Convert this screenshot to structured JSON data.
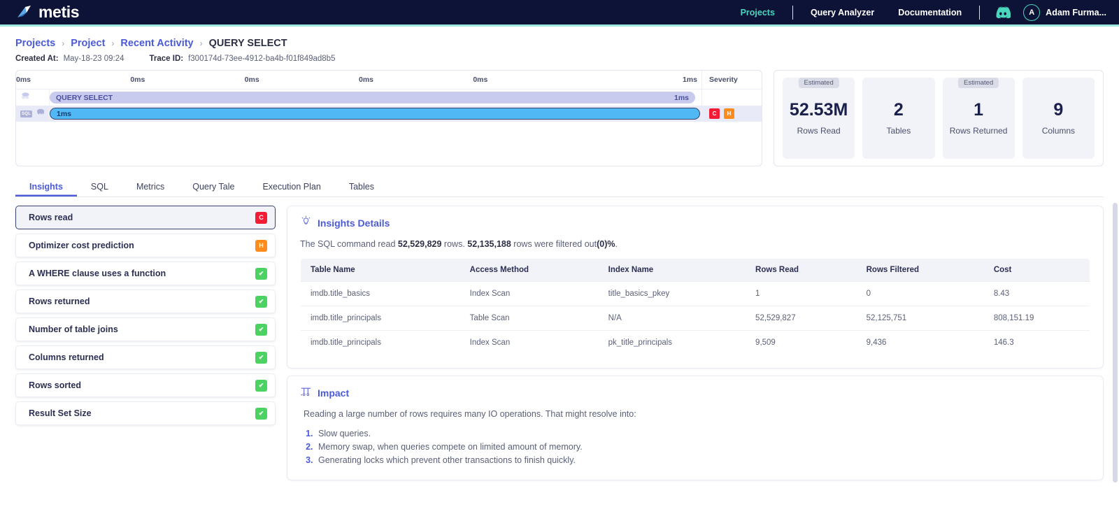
{
  "navbar": {
    "logo_text": "metis",
    "links": [
      {
        "label": "Projects",
        "active": true
      },
      {
        "label": "Query Analyzer",
        "active": false
      },
      {
        "label": "Documentation",
        "active": false
      }
    ],
    "discord_icon": "discord-icon",
    "avatar_initial": "A",
    "user_name": "Adam Furma..."
  },
  "breadcrumb": {
    "items": [
      {
        "label": "Projects"
      },
      {
        "label": "Project"
      },
      {
        "label": "Recent Activity"
      },
      {
        "label": "QUERY SELECT"
      }
    ],
    "separator": "›"
  },
  "meta": {
    "created_at_label": "Created At:",
    "created_at_value": "May-18-23 09:24",
    "trace_id_label": "Trace ID:",
    "trace_id_value": "f300174d-73ee-4912-ba4b-f01f849ad8b5"
  },
  "trace": {
    "ticks": [
      "0ms",
      "0ms",
      "0ms",
      "0ms",
      "0ms",
      "1ms"
    ],
    "severity_header": "Severity",
    "rows": [
      {
        "icon": "cloud-database-icon",
        "bar_label": "QUERY SELECT",
        "bar_duration": "1ms",
        "severities": []
      },
      {
        "icon_chip": "SQL",
        "icon": "postgres-elephant-icon",
        "bar_label": "1ms",
        "bar_duration": "",
        "severities": [
          {
            "code": "C",
            "level": "critical"
          },
          {
            "code": "H",
            "level": "high"
          }
        ]
      }
    ]
  },
  "stats": [
    {
      "badge": "Estimated",
      "value": "52.53M",
      "label": "Rows Read"
    },
    {
      "badge": "",
      "value": "2",
      "label": "Tables"
    },
    {
      "badge": "Estimated",
      "value": "1",
      "label": "Rows Returned"
    },
    {
      "badge": "",
      "value": "9",
      "label": "Columns"
    }
  ],
  "tabs": [
    {
      "label": "Insights",
      "active": true
    },
    {
      "label": "SQL",
      "active": false
    },
    {
      "label": "Metrics",
      "active": false
    },
    {
      "label": "Query Tale",
      "active": false
    },
    {
      "label": "Execution Plan",
      "active": false
    },
    {
      "label": "Tables",
      "active": false
    }
  ],
  "insights": [
    {
      "label": "Rows read",
      "badge": "C",
      "badge_type": "critical",
      "selected": true
    },
    {
      "label": "Optimizer cost prediction",
      "badge": "H",
      "badge_type": "high",
      "selected": false
    },
    {
      "label": "A WHERE clause uses a function",
      "badge": "✔",
      "badge_type": "ok",
      "selected": false
    },
    {
      "label": "Rows returned",
      "badge": "✔",
      "badge_type": "ok",
      "selected": false
    },
    {
      "label": "Number of table joins",
      "badge": "✔",
      "badge_type": "ok",
      "selected": false
    },
    {
      "label": "Columns returned",
      "badge": "✔",
      "badge_type": "ok",
      "selected": false
    },
    {
      "label": "Rows sorted",
      "badge": "✔",
      "badge_type": "ok",
      "selected": false
    },
    {
      "label": "Result Set Size",
      "badge": "✔",
      "badge_type": "ok",
      "selected": false
    }
  ],
  "details": {
    "title": "Insights Details",
    "icon": "lightbulb-icon",
    "description_parts": {
      "p1": "The SQL command read ",
      "b1": "52,529,829",
      "p2": " rows. ",
      "b2": "52,135,188",
      "p3": " rows were filtered out",
      "b3": "(0)%",
      "p4": "."
    },
    "table": {
      "columns": [
        "Table Name",
        "Access Method",
        "Index Name",
        "Rows Read",
        "Rows Filtered",
        "Cost"
      ],
      "rows": [
        {
          "table_name": "imdb.title_basics",
          "access_method": "Index Scan",
          "access_warn": false,
          "index_name": "title_basics_pkey",
          "rows_read": "1",
          "rows_filtered": "0",
          "cost": "8.43"
        },
        {
          "table_name": "imdb.title_principals",
          "access_method": "Table Scan",
          "access_warn": true,
          "index_name": "N/A",
          "rows_read": "52,529,827",
          "rows_filtered": "52,125,751",
          "cost": "808,151.19"
        },
        {
          "table_name": "imdb.title_principals",
          "access_method": "Index Scan",
          "access_warn": false,
          "index_name": "pk_title_principals",
          "rows_read": "9,509",
          "rows_filtered": "9,436",
          "cost": "146.3"
        }
      ]
    }
  },
  "impact": {
    "title": "Impact",
    "icon": "bar-chart-icon",
    "intro": "Reading a large number of rows requires many IO operations. That might resolve into:",
    "items": [
      "Slow queries.",
      "Memory swap, when queries compete on limited amount of memory.",
      "Generating locks which prevent other transactions to finish quickly."
    ]
  },
  "colors": {
    "navbar_bg": "#0d1336",
    "accent_teal": "#4ad6bd",
    "link_indigo": "#4b5bd6",
    "critical_red": "#f21c34",
    "high_orange": "#ff8c1a",
    "ok_green": "#4cd263",
    "warn_text": "#f2786e",
    "bar_parent": "#c8cbee",
    "bar_child": "#4fb8f5"
  }
}
